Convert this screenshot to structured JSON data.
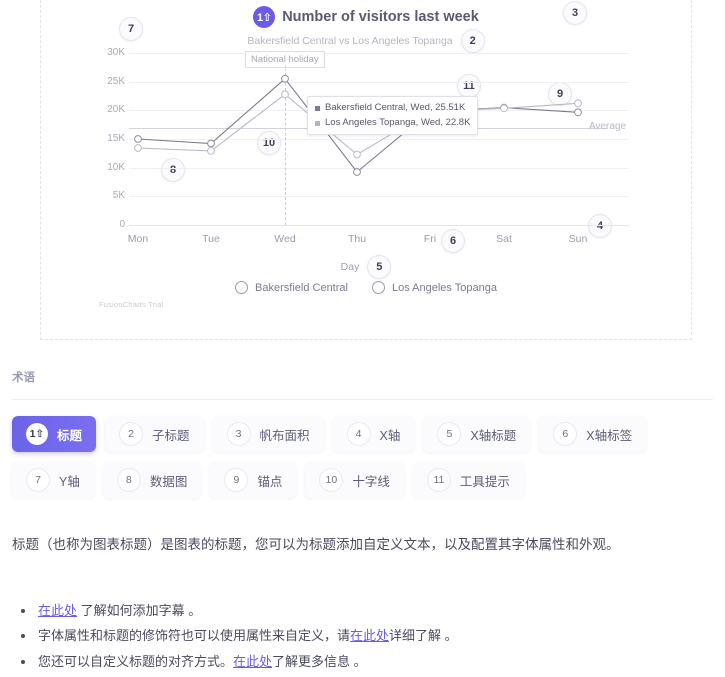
{
  "chart_data": {
    "type": "line",
    "title": "Number of visitors last week",
    "subtitle": "Bakersfield Central vs Los Angeles Topanga",
    "xlabel": "Day",
    "ylabel": "",
    "categories": [
      "Mon",
      "Tue",
      "Wed",
      "Thu",
      "Fri",
      "Sat",
      "Sun"
    ],
    "ytick_labels": [
      "0",
      "5K",
      "10K",
      "15K",
      "20K",
      "25K",
      "30K"
    ],
    "ylim": [
      0,
      30000
    ],
    "grid": true,
    "legend_position": "bottom",
    "series": [
      {
        "name": "Bakersfield Central",
        "color": "#7c7c90",
        "values": [
          15000,
          14200,
          25510,
          9200,
          19800,
          20500,
          19600
        ]
      },
      {
        "name": "Los Angeles Topanga",
        "color": "#b3b3c0",
        "values": [
          13400,
          12900,
          22800,
          12300,
          19800,
          20400,
          21200
        ]
      }
    ],
    "average_line": {
      "label": "Average",
      "value": 17000
    },
    "annotation": {
      "label": "National holiday",
      "at_category": "Wed"
    },
    "crossline": {
      "at_category": "Wed"
    },
    "tooltip": {
      "rows": [
        {
          "label": "Bakersfield Central, Wed, 25.51K",
          "color": "#7c7c90"
        },
        {
          "label": "Los Angeles Topanga, Wed, 22.8K",
          "color": "#b3b3c0"
        }
      ]
    },
    "watermark": "FusionCharts Trial"
  },
  "callouts": [
    {
      "id": "title",
      "number": "1"
    },
    {
      "id": "subtitle",
      "number": "2"
    },
    {
      "id": "canvas",
      "number": "3"
    },
    {
      "id": "x-axis",
      "number": "4"
    },
    {
      "id": "x-axis-title",
      "number": "5"
    },
    {
      "id": "x-axis-labels",
      "number": "6"
    },
    {
      "id": "y-axis",
      "number": "7"
    },
    {
      "id": "data-plot",
      "number": "8"
    },
    {
      "id": "anchor",
      "number": "9"
    },
    {
      "id": "crossline",
      "number": "10"
    },
    {
      "id": "tooltip",
      "number": "11"
    }
  ],
  "terminology": {
    "heading": "术语",
    "chips": [
      {
        "num": "1",
        "label": "标题",
        "active": true,
        "icon": "up-arrow-icon"
      },
      {
        "num": "2",
        "label": "子标题",
        "active": false
      },
      {
        "num": "3",
        "label": "帆布面积",
        "active": false
      },
      {
        "num": "4",
        "label": "X轴",
        "active": false
      },
      {
        "num": "5",
        "label": "X轴标题",
        "active": false
      },
      {
        "num": "6",
        "label": "X轴标签",
        "active": false
      },
      {
        "num": "7",
        "label": "Y轴",
        "active": false
      },
      {
        "num": "8",
        "label": "数据图",
        "active": false
      },
      {
        "num": "9",
        "label": "锚点",
        "active": false
      },
      {
        "num": "10",
        "label": "十字线",
        "active": false
      },
      {
        "num": "11",
        "label": "工具提示",
        "active": false
      }
    ]
  },
  "content": {
    "paragraph": "标题（也称为图表标题）是图表的标题，您可以为标题添加自定义文本，以及配置其字体属性和外观。",
    "bullets": [
      {
        "before": "",
        "link": "在此处",
        "after": " 了解如何添加字幕 。"
      },
      {
        "before": "字体属性和标题的修饰符也可以使用属性来自定义，请",
        "link": "在此处",
        "after": "详细了解 。"
      },
      {
        "before": "您还可以自定义标题的对齐方式。",
        "link": "在此处",
        "after": "了解更多信息 。"
      }
    ]
  },
  "colors": {
    "accent": "#6b5ce7",
    "link": "#6b5ce7",
    "series1": "#7c7c90",
    "series2": "#b3b3c0"
  }
}
